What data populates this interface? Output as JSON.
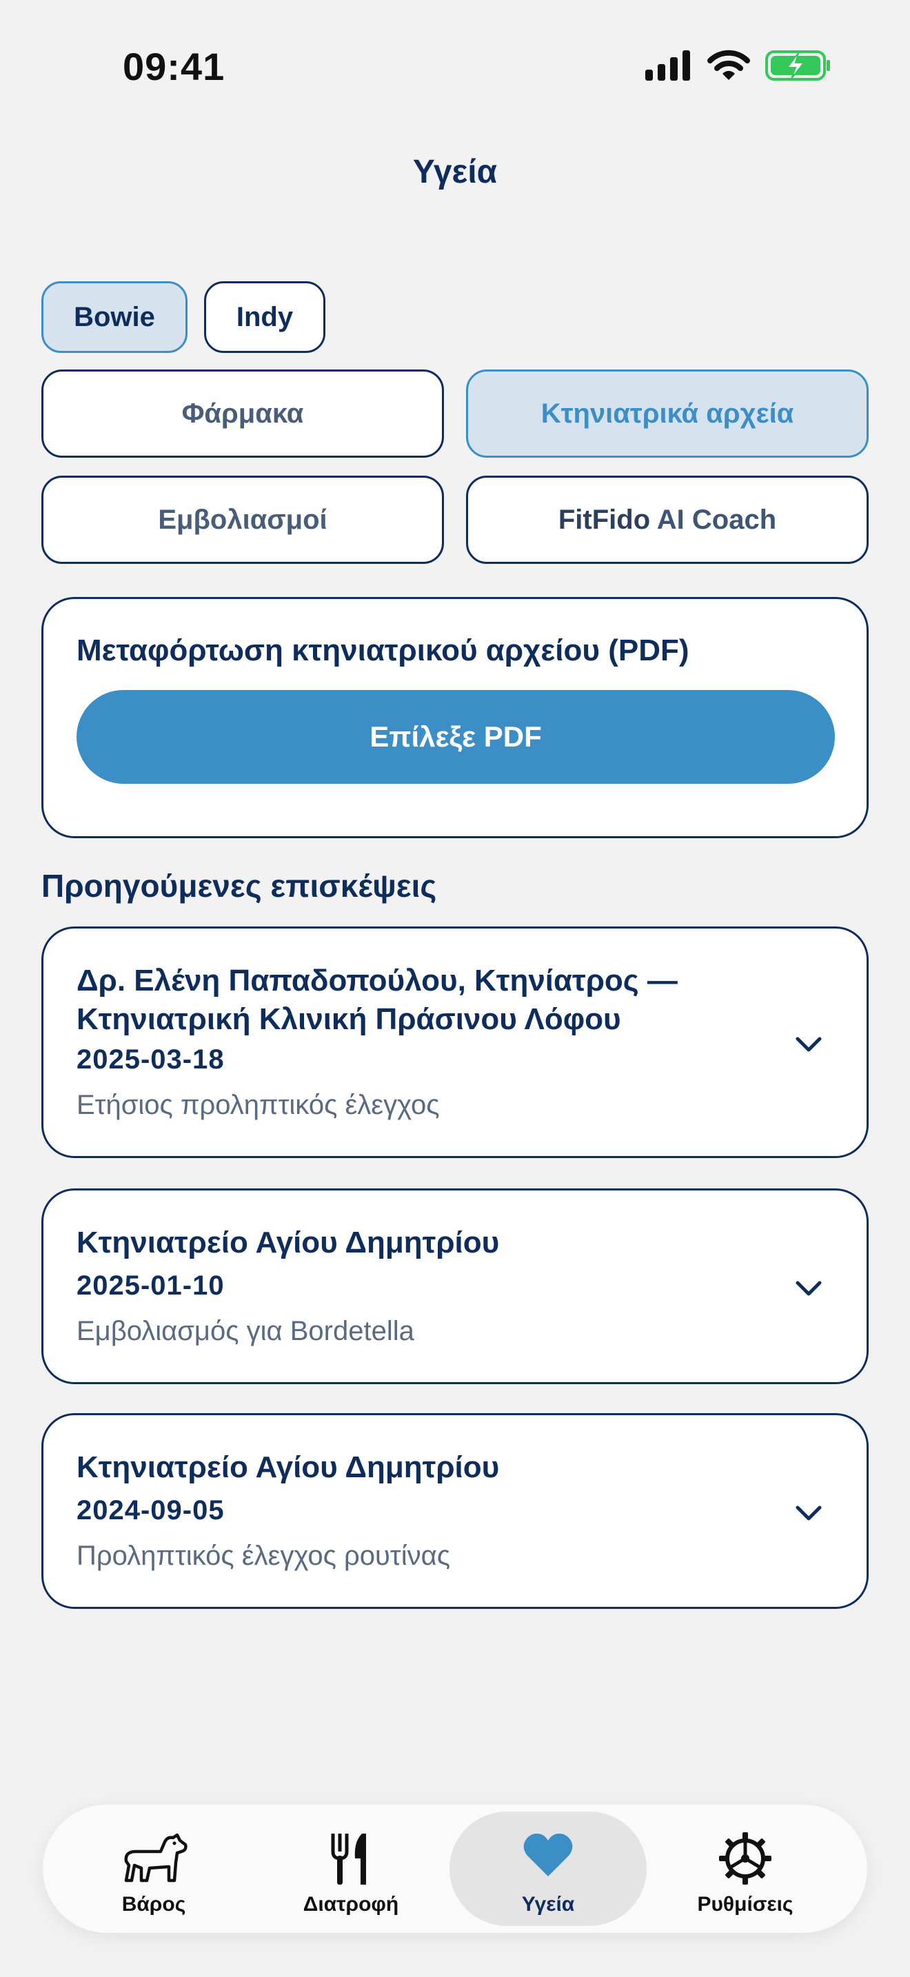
{
  "status_bar": {
    "time": "09:41"
  },
  "header": {
    "title": "Υγεία"
  },
  "pets": [
    {
      "name": "Bowie",
      "selected": true
    },
    {
      "name": "Indy",
      "selected": false
    }
  ],
  "sections": {
    "medications": "Φάρμακα",
    "vet_records": "Κτηνιατρικά αρχεία",
    "vaccinations": "Εμβολιασμοί",
    "coach_brand": "FitFido",
    "coach_suffix": " AI Coach",
    "selected": "vet_records"
  },
  "upload": {
    "title": "Μεταφόρτωση κτηνιατρικού αρχείου (PDF)",
    "button_label": "Επίλεξε PDF"
  },
  "visits": {
    "title": "Προηγούμενες επισκέψεις",
    "items": [
      {
        "clinic": "Δρ. Ελένη Παπαδοπούλου, Κτηνίατρος — Κτηνιατρική Κλινική Πράσινου Λόφου",
        "date": "2025-03-18",
        "reason": "Ετήσιος προληπτικός έλεγχος"
      },
      {
        "clinic": "Κτηνιατρείο Αγίου Δημητρίου",
        "date": "2025-01-10",
        "reason": "Εμβολιασμός για Bordetella"
      },
      {
        "clinic": "Κτηνιατρείο Αγίου Δημητρίου",
        "date": "2024-09-05",
        "reason": "Προληπτικός έλεγχος ρουτίνας"
      }
    ]
  },
  "tab_bar": {
    "items": [
      {
        "label": "Βάρος",
        "icon": "dog-icon"
      },
      {
        "label": "Διατροφή",
        "icon": "fork-knife-icon"
      },
      {
        "label": "Υγεία",
        "icon": "heart-icon",
        "active": true
      },
      {
        "label": "Ρυθμίσεις",
        "icon": "gear-icon"
      }
    ]
  },
  "colors": {
    "primary": "#0f2d5c",
    "accent": "#3b8ec6",
    "selected_bg": "#d6e3ee",
    "background": "#f2f2f2",
    "battery": "#34c759"
  }
}
